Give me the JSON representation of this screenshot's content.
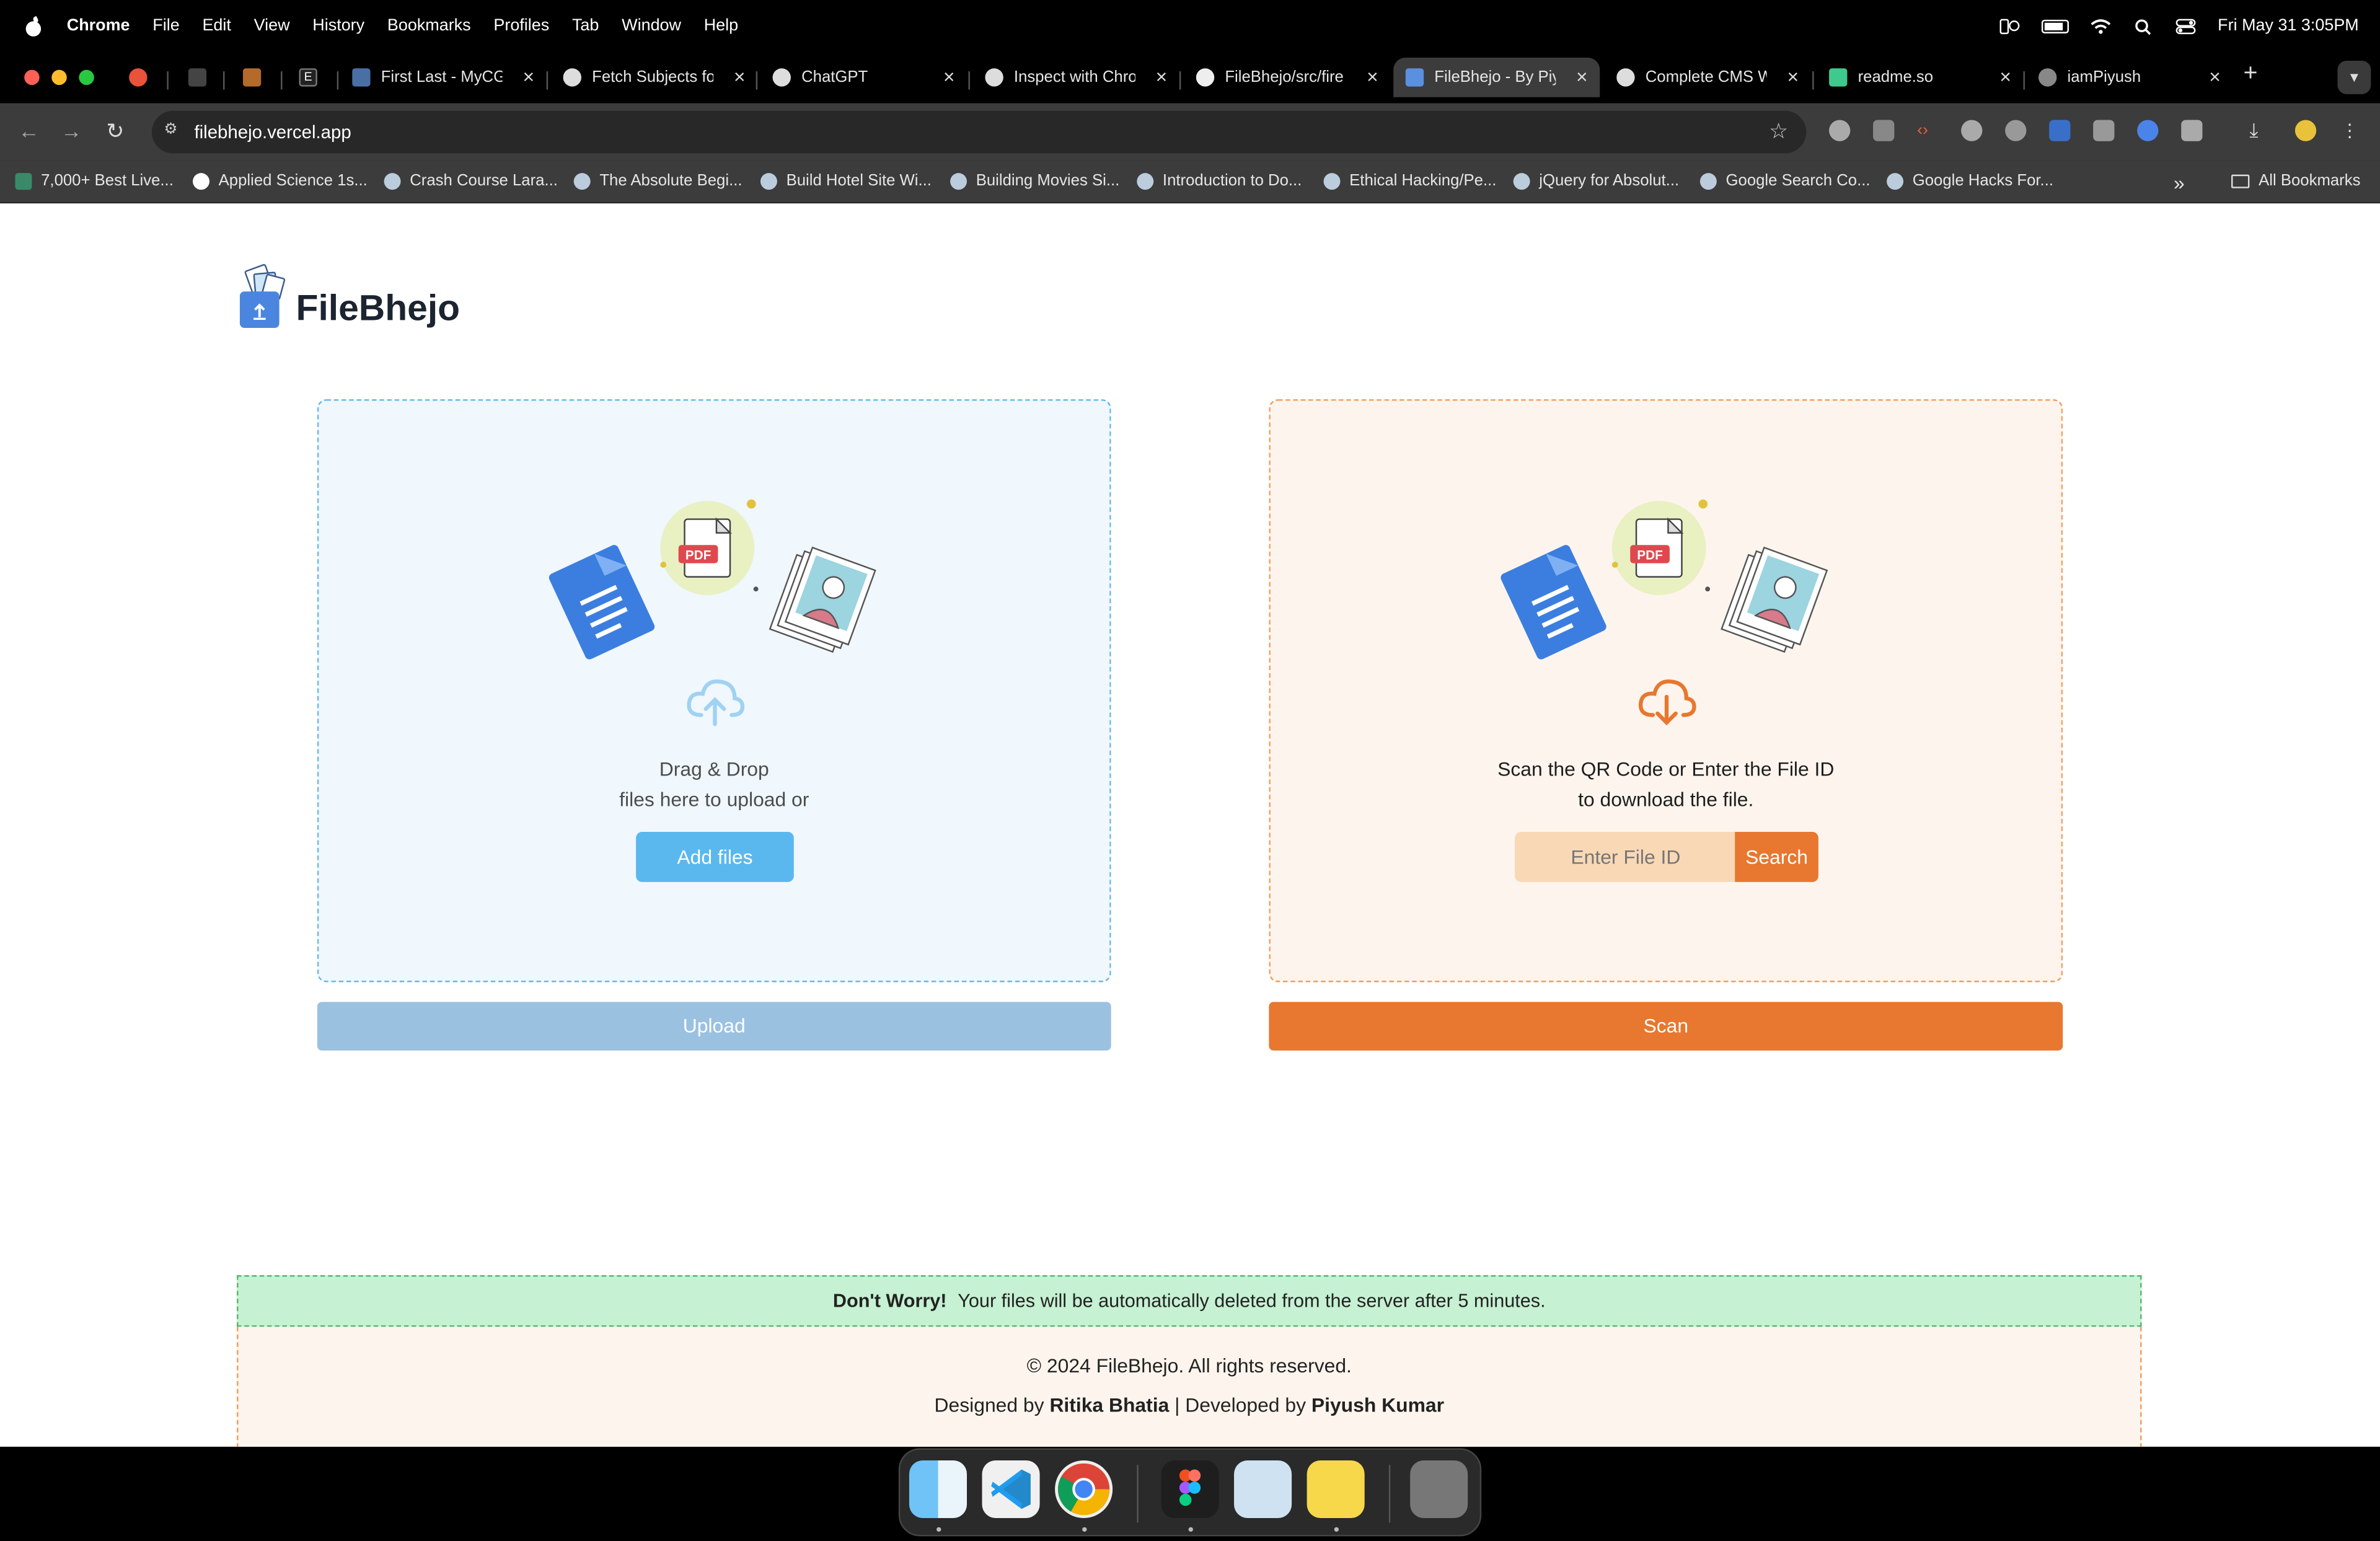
{
  "menubar": {
    "app": "Chrome",
    "items": [
      "File",
      "Edit",
      "View",
      "History",
      "Bookmarks",
      "Profiles",
      "Tab",
      "Window",
      "Help"
    ],
    "datetime": "Fri May 31  3:05PM"
  },
  "tabs": [
    {
      "title": "",
      "fav": "#e8533a"
    },
    {
      "title": "",
      "fav": "#555"
    },
    {
      "title": "",
      "fav": "#b36a2a"
    },
    {
      "title": "E",
      "fav": "#333"
    },
    {
      "title": "First Last - MyCG",
      "fav": "#4a6fa5"
    },
    {
      "title": "Fetch Subjects fo",
      "fav": "#ddd"
    },
    {
      "title": "ChatGPT",
      "fav": "#ddd"
    },
    {
      "title": "Inspect with Chro",
      "fav": "#ddd"
    },
    {
      "title": "FileBhejo/src/fire",
      "fav": "#eee"
    },
    {
      "title": "FileBhejo - By Piy",
      "fav": "#5b8fe0"
    },
    {
      "title": "Complete CMS W",
      "fav": "#ddd"
    },
    {
      "title": "readme.so",
      "fav": "#3ec98d"
    },
    {
      "title": "iamPiyush",
      "fav": "#888"
    }
  ],
  "toolbar": {
    "url": "filebhejo.vercel.app"
  },
  "bookmarks": [
    "7,000+ Best Live...",
    "Applied Science 1s...",
    "Crash Course Lara...",
    "The Absolute Begi...",
    "Build Hotel Site Wi...",
    "Building Movies Si...",
    "Introduction to Do...",
    "Ethical Hacking/Pe...",
    "jQuery for Absolut...",
    "Google Search Co...",
    "Google Hacks For..."
  ],
  "all_bookmarks": "All Bookmarks",
  "app": {
    "brand": "FileBhejo",
    "upload": {
      "line1": "Drag & Drop",
      "line2": "files here to upload or",
      "add_label": "Add files",
      "button": "Upload"
    },
    "download": {
      "line1": "Scan the QR Code or Enter the File ID",
      "line2": "to download the file.",
      "placeholder": "Enter File ID",
      "search_label": "Search",
      "button": "Scan"
    },
    "pdf_label": "PDF",
    "notice_bold": "Don't Worry!",
    "notice_text": "Your files will be automatically deleted from the server after 5 minutes.",
    "copyright": "© 2024 FileBhejo. All rights reserved.",
    "designed_by": "Designed by",
    "designer": "Ritika Bhatia",
    "developed_by": "| Developed by",
    "developer": "Piyush Kumar"
  },
  "colors": {
    "upload_accent": "#5ab8ef",
    "download_accent": "#e8772f",
    "notice_bg": "#c6f1d3"
  }
}
